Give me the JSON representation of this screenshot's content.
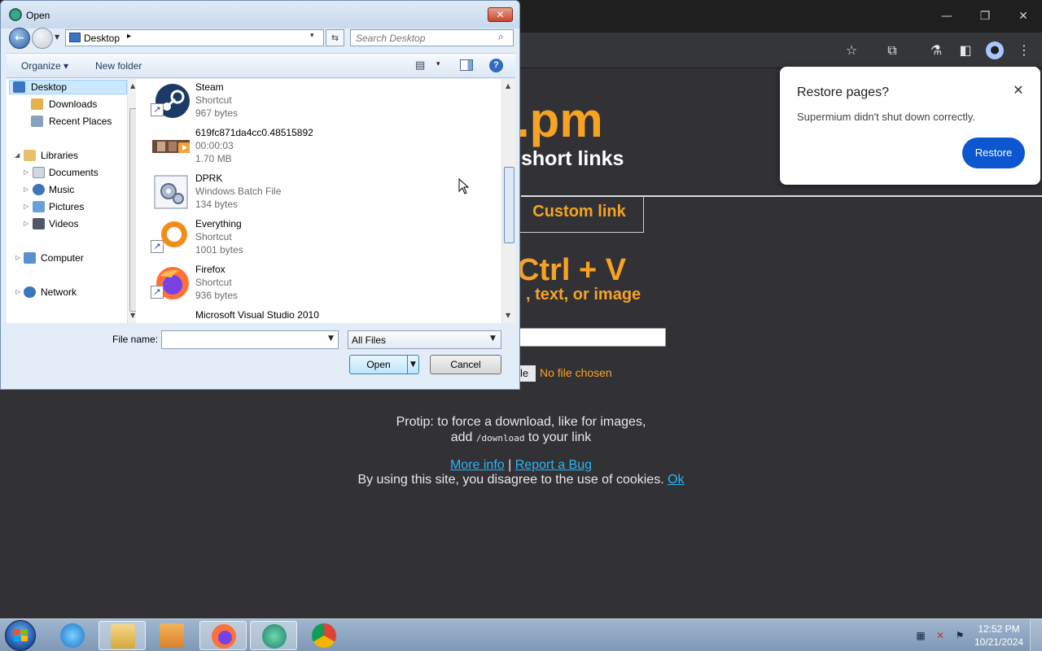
{
  "browser": {
    "window_controls": {
      "minimize": "—",
      "restore": "❐",
      "close": "✕"
    },
    "toolbar_icons": {
      "bookmark": "☆",
      "extensions": "⧉",
      "labs": "⚗",
      "sidepanel": "◧",
      "menu": "⋮"
    },
    "page": {
      "title_fragment": ".pm",
      "subtitle_fragment": "short links",
      "tab_label": "Custom link",
      "paste_hint": "Ctrl + V",
      "paste_sub": ", text, or image",
      "choose_file_fragment": "le",
      "no_file_label": "No file chosen",
      "protip_line1": "Protip: to force a download, like for images,",
      "protip_add": "add",
      "protip_code": "/download",
      "protip_tail": "to your link",
      "more_info": "More info",
      "separator": "|",
      "report_bug": "Report a Bug",
      "cookie_text": "By using this site, you disagree to the use of cookies.",
      "cookie_ok": "Ok"
    },
    "restore_popup": {
      "title": "Restore pages?",
      "message": "Supermium didn't shut down correctly.",
      "button": "Restore",
      "close": "✕"
    }
  },
  "dialog": {
    "title": "Open",
    "close": "✕",
    "address": {
      "location": "Desktop",
      "separator": "▸",
      "dropdown": "▾"
    },
    "search_placeholder": "Search Desktop",
    "commands": {
      "organize": "Organize ▾",
      "new_folder": "New folder",
      "views_dropdown": "▾",
      "help": "?"
    },
    "nav": {
      "favorites": [
        "Desktop",
        "Downloads",
        "Recent Places"
      ],
      "libraries": "Libraries",
      "library_items": [
        "Documents",
        "Music",
        "Pictures",
        "Videos"
      ],
      "computer": "Computer",
      "network": "Network"
    },
    "files": [
      {
        "name": "Steam",
        "type": "Shortcut",
        "size": "967 bytes"
      },
      {
        "name": "619fc871da4cc0.48515892",
        "type": "00:00:03",
        "size": "1.70 MB"
      },
      {
        "name": "DPRK",
        "type": "Windows Batch File",
        "size": "134 bytes"
      },
      {
        "name": "Everything",
        "type": "Shortcut",
        "size": "1001 bytes"
      },
      {
        "name": "Firefox",
        "type": "Shortcut",
        "size": "936 bytes"
      },
      {
        "name": "Microsoft Visual Studio 2010",
        "type": "",
        "size": ""
      }
    ],
    "file_name_label": "File name:",
    "file_name_value": "",
    "file_type": "All Files",
    "open_button": "Open",
    "cancel_button": "Cancel"
  },
  "taskbar": {
    "clock_time": "12:52 PM",
    "clock_date": "10/21/2024"
  },
  "colors": {
    "accent_orange": "#f6a324",
    "link_blue": "#29b6f6",
    "restore_blue": "#0b57d0",
    "page_bg": "#323236"
  }
}
